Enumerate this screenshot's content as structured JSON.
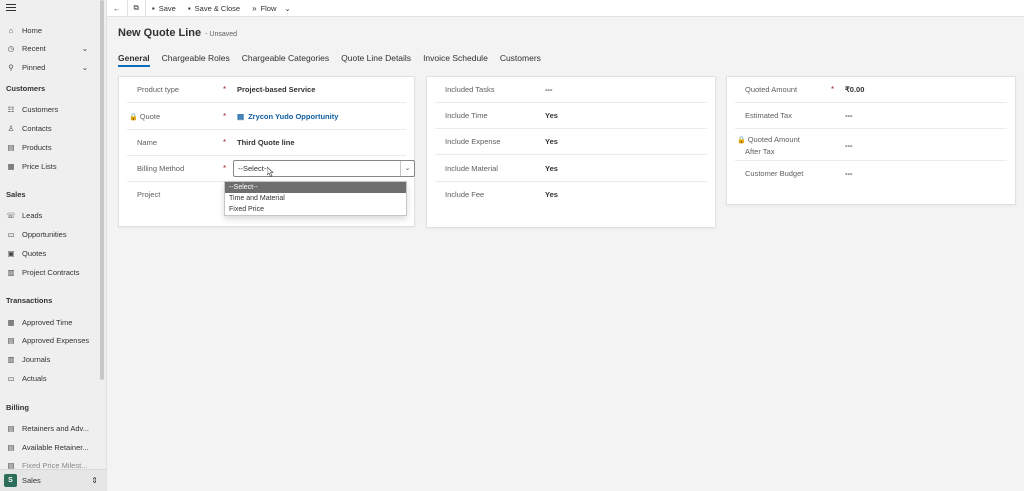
{
  "sidebar": {
    "nav_top": [
      {
        "label": "Home",
        "icon": "home-icon"
      },
      {
        "label": "Recent",
        "icon": "clock-icon"
      },
      {
        "label": "Pinned",
        "icon": "pin-icon"
      }
    ],
    "sections": [
      {
        "title": "Customers",
        "items": [
          "Customers",
          "Contacts",
          "Products",
          "Price Lists"
        ]
      },
      {
        "title": "Sales",
        "items": [
          "Leads",
          "Opportunities",
          "Quotes",
          "Project Contracts"
        ]
      },
      {
        "title": "Transactions",
        "items": [
          "Approved Time",
          "Approved Expenses",
          "Journals",
          "Actuals"
        ]
      },
      {
        "title": "Billing",
        "items": [
          "Retainers and Adv...",
          "Available Retainer...",
          "Fixed Price Milest..."
        ]
      }
    ],
    "area": {
      "badge": "S",
      "label": "Sales"
    }
  },
  "commandbar": {
    "save": "Save",
    "save_close": "Save & Close",
    "flow": "Flow"
  },
  "header": {
    "title": "New Quote Line",
    "status": "- Unsaved"
  },
  "tabs": [
    "General",
    "Chargeable Roles",
    "Chargeable Categories",
    "Quote Line Details",
    "Invoice Schedule",
    "Customers"
  ],
  "card1": {
    "product_type": {
      "label": "Product type",
      "value": "Project-based Service"
    },
    "quote": {
      "label": "Quote",
      "value": "Zrycon Yudo Opportunity"
    },
    "name": {
      "label": "Name",
      "value": "Third Quote line"
    },
    "billing_method": {
      "label": "Billing Method",
      "value": "--Select--"
    },
    "project": {
      "label": "Project"
    },
    "required_marker": "*"
  },
  "dropdown": {
    "options": [
      "--Select--",
      "Time and Material",
      "Fixed Price"
    ]
  },
  "card2": {
    "rows": [
      {
        "label": "Included Tasks",
        "value": "---"
      },
      {
        "label": "Include Time",
        "value": "Yes"
      },
      {
        "label": "Include Expense",
        "value": "Yes"
      },
      {
        "label": "Include Material",
        "value": "Yes"
      },
      {
        "label": "Include Fee",
        "value": "Yes"
      }
    ]
  },
  "card3": {
    "rows": [
      {
        "label": "Quoted Amount",
        "value": "₹0.00",
        "required": "*"
      },
      {
        "label": "Estimated Tax",
        "value": "---"
      },
      {
        "label_line1": "Quoted Amount",
        "label_line2": "After Tax",
        "value": "---"
      },
      {
        "label": "Customer Budget",
        "value": "---"
      }
    ]
  },
  "colors": {
    "accent": "#0f6cbd",
    "required": "#a4262c",
    "link": "#115ea3",
    "area_badge": "#2d6e5a"
  }
}
